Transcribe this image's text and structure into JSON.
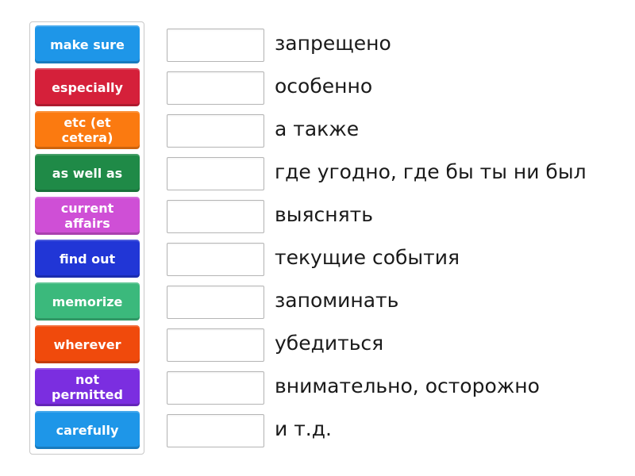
{
  "activity": {
    "type": "match-up",
    "tiles": [
      {
        "label": "make sure",
        "color": "#1e96e8"
      },
      {
        "label": "especially",
        "color": "#d5203a"
      },
      {
        "label": "etc (et cetera)",
        "color": "#fb7a10"
      },
      {
        "label": "as well as",
        "color": "#1f8a47"
      },
      {
        "label": "current affairs",
        "color": "#cf4fd6"
      },
      {
        "label": "find out",
        "color": "#2136d6"
      },
      {
        "label": "memorize",
        "color": "#3bb97c"
      },
      {
        "label": "wherever",
        "color": "#f04a0c"
      },
      {
        "label": "not permitted",
        "color": "#7b2ee0"
      },
      {
        "label": "carefully",
        "color": "#1e96e8"
      }
    ],
    "targets": [
      {
        "text": "запрещено",
        "value": ""
      },
      {
        "text": "особенно",
        "value": ""
      },
      {
        "text": "а также",
        "value": ""
      },
      {
        "text": "где угодно, где бы ты ни был",
        "value": ""
      },
      {
        "text": "выяснять",
        "value": ""
      },
      {
        "text": "текущие события",
        "value": ""
      },
      {
        "text": "запоминать",
        "value": ""
      },
      {
        "text": "убедиться",
        "value": ""
      },
      {
        "text": "внимательно, осторожно",
        "value": ""
      },
      {
        "text": "и т.д.",
        "value": ""
      }
    ]
  }
}
